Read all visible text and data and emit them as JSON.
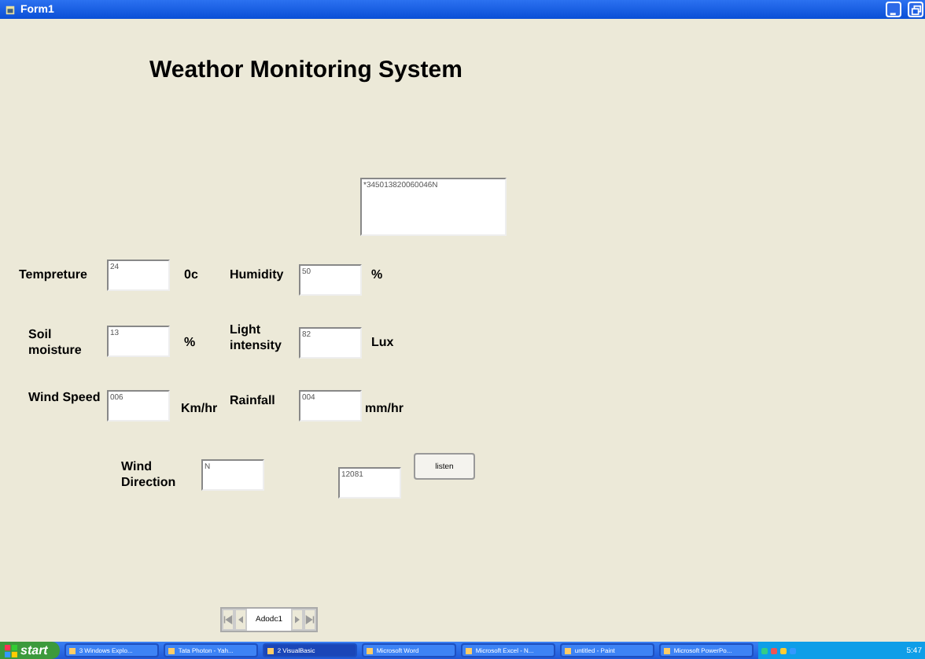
{
  "window": {
    "title": "Form1"
  },
  "heading": "Weathor Monitoring System",
  "raw_box": {
    "value": "*345013820060046N"
  },
  "fields": [
    {
      "label": "Tempreture",
      "value": "24",
      "unit": "0c"
    },
    {
      "label": "Humidity",
      "value": "50",
      "unit": "%"
    },
    {
      "label": "Soil moisture",
      "value": "13",
      "unit": "%"
    },
    {
      "label": "Light intensity",
      "value": "82",
      "unit": "Lux"
    },
    {
      "label": "Wind Speed",
      "value": "006",
      "unit": "Km/hr"
    },
    {
      "label": "Rainfall",
      "value": "004",
      "unit": "mm/hr"
    }
  ],
  "wind_direction": {
    "label": "Wind Direction",
    "value": "N"
  },
  "port_box": {
    "value": "12081"
  },
  "listen_button": "listen",
  "data_control": {
    "caption": "Adodc1"
  },
  "taskbar": {
    "start": "start",
    "items": [
      {
        "label": "3 Windows Explo...",
        "selected": false
      },
      {
        "label": "Tata Photon - Yah...",
        "selected": false
      },
      {
        "label": "2 VisualBasic",
        "selected": true
      },
      {
        "label": "Microsoft Word",
        "selected": false
      },
      {
        "label": "Microsoft Excel - N...",
        "selected": false
      },
      {
        "label": "untitled - Paint",
        "selected": false
      },
      {
        "label": "Microsoft PowerPo...",
        "selected": false
      }
    ],
    "clock": "5:47"
  }
}
